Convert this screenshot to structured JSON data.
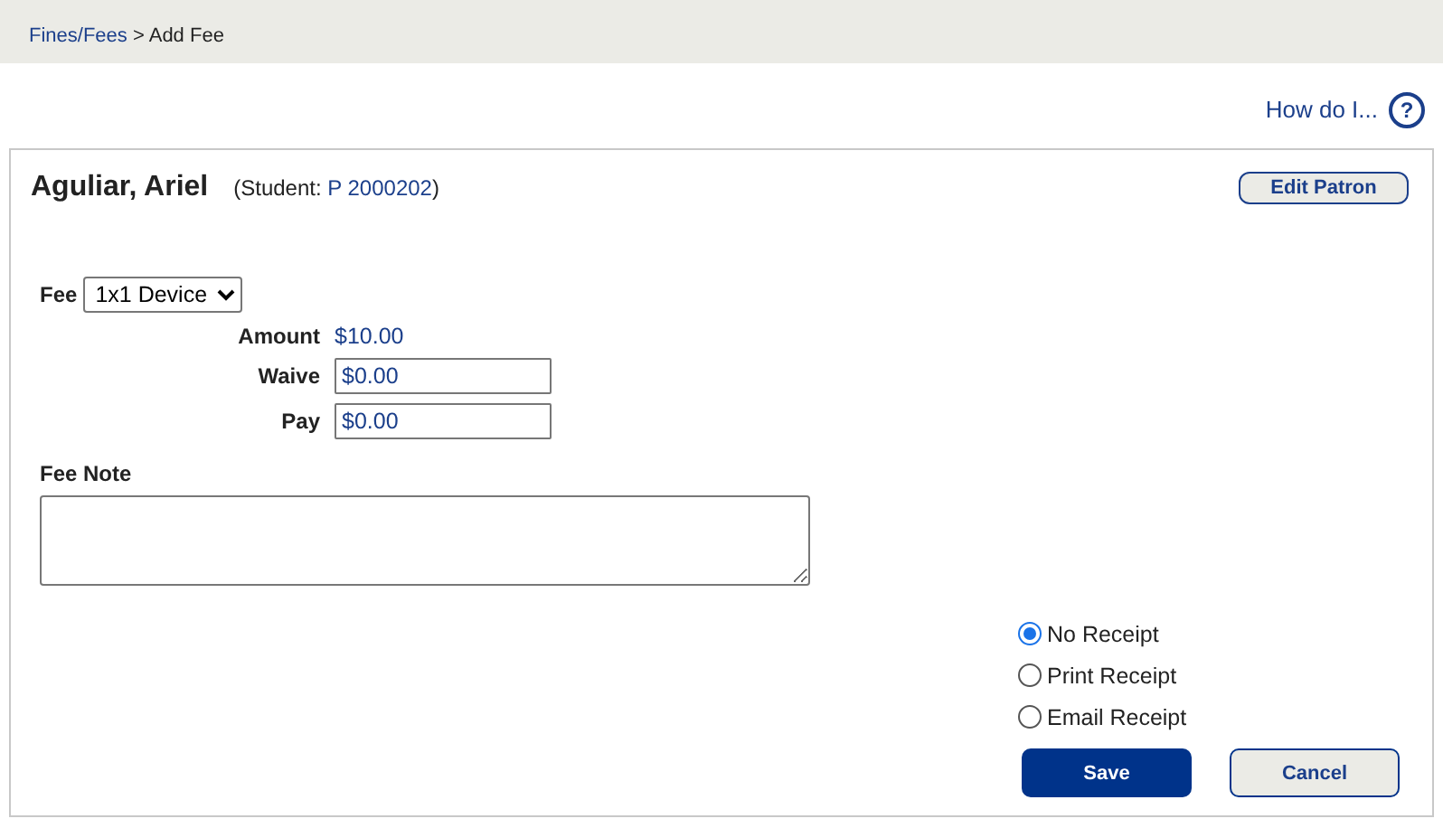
{
  "breadcrumb": {
    "link": "Fines/Fees",
    "separator": ">",
    "current": "Add Fee"
  },
  "help": {
    "label": "How do I...",
    "icon": "?"
  },
  "patron": {
    "name": "Aguliar, Ariel",
    "type_prefix": "(Student:",
    "barcode": "P 2000202",
    "type_suffix": ")"
  },
  "edit_button": "Edit Patron",
  "fee": {
    "label": "Fee",
    "value": "1x1 Device"
  },
  "amounts": [
    {
      "kind": "text",
      "label": "Amount",
      "value": "$10.00"
    },
    {
      "kind": "input",
      "label": "Waive",
      "value": "$0.00"
    },
    {
      "kind": "input",
      "label": "Pay",
      "value": "$0.00"
    }
  ],
  "note": {
    "label": "Fee Note"
  },
  "receipts": [
    {
      "label": "No Receipt",
      "selected": true
    },
    {
      "label": "Print Receipt",
      "selected": false
    },
    {
      "label": "Email Receipt",
      "selected": false
    }
  ],
  "buttons": [
    {
      "kind": "primary",
      "label": "Save"
    },
    {
      "kind": "secondary",
      "label": "Cancel"
    }
  ]
}
